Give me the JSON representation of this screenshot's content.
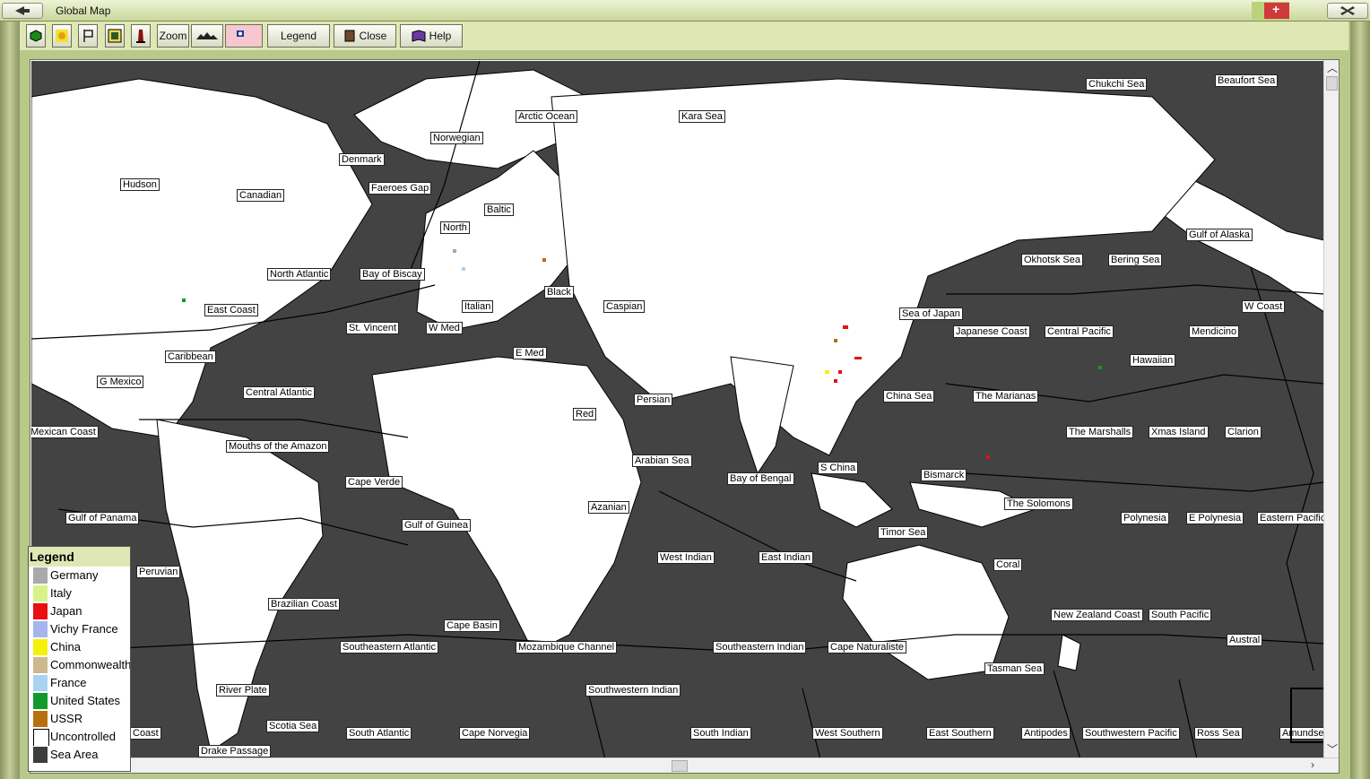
{
  "window": {
    "title": "Global Map"
  },
  "toolbar": {
    "zoom_label": "Zoom",
    "legend_label": "Legend",
    "close_label": "Close",
    "help_label": "Help"
  },
  "legend": {
    "title": "Legend",
    "items": [
      {
        "label": "Germany",
        "color": "#a9a9a9"
      },
      {
        "label": "Italy",
        "color": "#d8f28a"
      },
      {
        "label": "Japan",
        "color": "#e81010"
      },
      {
        "label": "Vichy France",
        "color": "#a7b4ef"
      },
      {
        "label": "China",
        "color": "#f5f10a"
      },
      {
        "label": "Commonwealth",
        "color": "#cdb98c"
      },
      {
        "label": "France",
        "color": "#a9d2f0"
      },
      {
        "label": "United States",
        "color": "#0f9a2a"
      },
      {
        "label": "USSR",
        "color": "#b8700f"
      },
      {
        "label": "Uncontrolled",
        "color": "#ffffff"
      },
      {
        "label": "Sea Area",
        "color": "#3d3d3d"
      }
    ]
  },
  "map": {
    "labels": [
      "Arctic Ocean",
      "Kara Sea",
      "Chukchi Sea",
      "Beaufort Sea",
      "Norwegian",
      "Denmark",
      "Hudson",
      "Canadian",
      "Faeroes Gap",
      "Baltic",
      "North",
      "North Atlantic",
      "Bay of Biscay",
      "Black",
      "Caspian",
      "Italian",
      "East Coast",
      "St. Vincent",
      "W Med",
      "E Med",
      "Caribbean",
      "G Mexico",
      "Central Atlantic",
      "Persian",
      "Red",
      "Mexican Coast",
      "Mouths of the Amazon",
      "Cape Verde",
      "Arabian Sea",
      "Bay of Bengal",
      "Gulf of Panama",
      "Gulf of Guinea",
      "Azanian",
      "Peruvian",
      "West Indian",
      "East Indian",
      "Brazilian Coast",
      "Cape Basin",
      "Southeastern Atlantic",
      "Mozambique Channel",
      "Southeastern Indian",
      "Cape Naturaliste",
      "Southwestern Indian",
      "River Plate",
      "Scotia Sea",
      "South Atlantic",
      "Cape Norvegia",
      "South Indian",
      "West Southern",
      "East Southern",
      "Antipodes",
      "Southwestern Pacific",
      "Ross Sea",
      "Amundsen",
      "Drake Passage",
      "Coast",
      "Okhotsk Sea",
      "Bering Sea",
      "Gulf of Alaska",
      "W Coast",
      "Sea of Japan",
      "Japanese Coast",
      "Central Pacific",
      "Mendicino",
      "Hawaiian",
      "China Sea",
      "The Marianas",
      "The Marshalls",
      "Xmas Island",
      "Clarion",
      "S China",
      "Bismarck",
      "The Solomons",
      "Polynesia",
      "E Polynesia",
      "Eastern Pacific",
      "Timor Sea",
      "Coral",
      "New Zealand Coast",
      "South Pacific",
      "Austral",
      "Tasman Sea"
    ]
  }
}
